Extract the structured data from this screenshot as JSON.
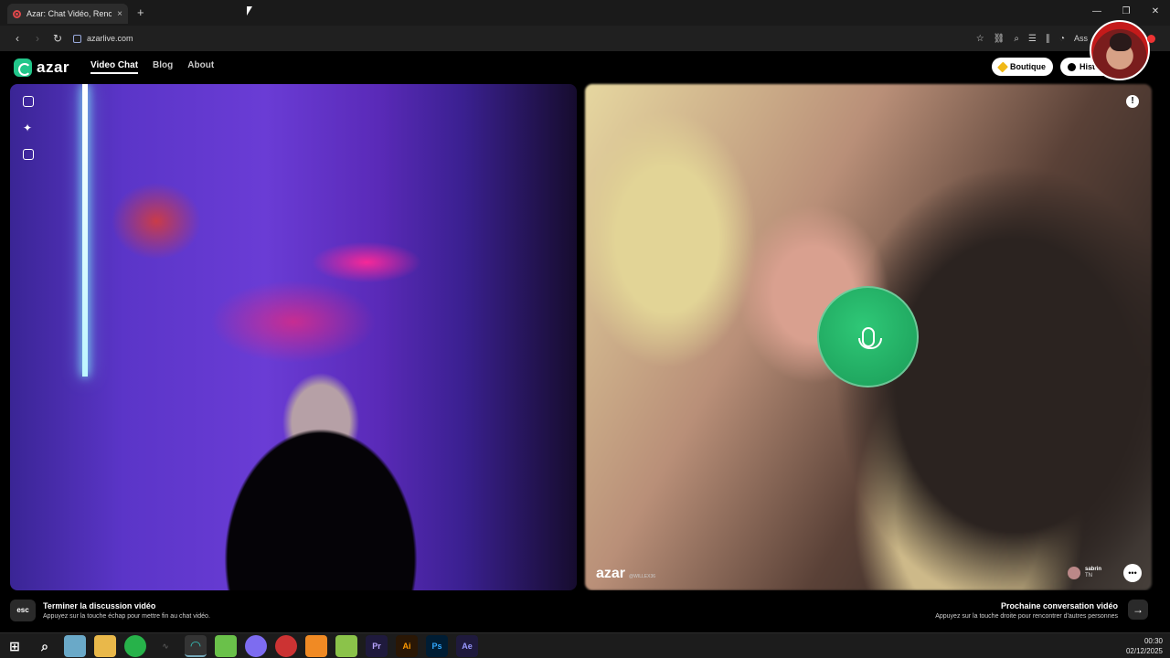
{
  "browser": {
    "tab_title": "Azar: Chat Vidéo, Rencontrer",
    "tab_close": "×",
    "new_tab": "+",
    "window_controls": [
      "—",
      "❐",
      "✕"
    ],
    "url": "azarlive.com",
    "assistant_label": "Ass"
  },
  "app": {
    "logo_text": "azar",
    "nav": [
      "Video Chat",
      "Blog",
      "About"
    ],
    "boutique_label": "Boutique",
    "history_label": "Histo"
  },
  "right_video": {
    "watermark": "azar",
    "watermark_id": "@WILLEX36",
    "peer_name": "sabrin",
    "peer_country": "TN"
  },
  "hints": {
    "esc_key": "esc",
    "end_title": "Terminer la discussion vidéo",
    "end_sub": "Appuyez sur la touche échap pour mettre fin au chat vidéo.",
    "next_title": "Prochaine conversation vidéo",
    "next_sub": "Appuyez sur la touche droite pour rencontrer d'autres personnes"
  },
  "taskbar": {
    "apps": [
      "windows-start",
      "search",
      "files",
      "folder",
      "whatsapp",
      "audio",
      "azar-browser",
      "android",
      "discord",
      "chrome",
      "fl-studio",
      "bluestacks",
      "Pr",
      "Ai",
      "Ps",
      "Ae"
    ],
    "time": "00:30",
    "date": "02/12/2025"
  },
  "colors": {
    "accent_green": "#22c68a",
    "mic_green": "#1a9b57",
    "boutique_gem": "#f0b816"
  }
}
